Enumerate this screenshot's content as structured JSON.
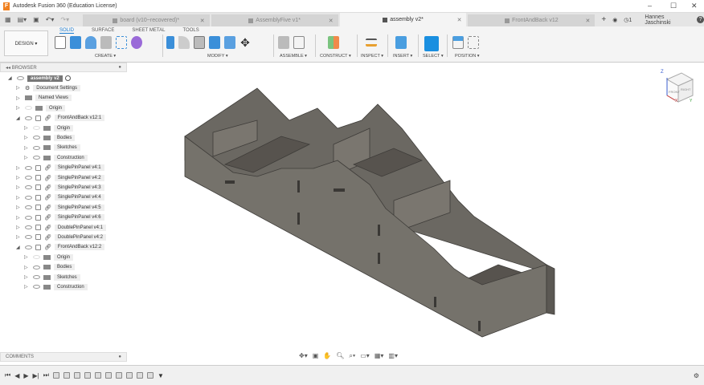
{
  "window": {
    "title": "Autodesk Fusion 360 (Education License)",
    "min": "–",
    "max": "☐",
    "close": "✕"
  },
  "tabs": [
    {
      "label": "board (v10~recovered)*"
    },
    {
      "label": "AssemblyFive v1*"
    },
    {
      "label": "assembly v2*",
      "active": true
    },
    {
      "label": "FrontAndBack v12"
    }
  ],
  "user": {
    "name": "Hannes Jaschinski",
    "jobs": "1",
    "help": "?"
  },
  "toolbar": {
    "workspace": "DESIGN ▾",
    "tabs": [
      "SOLID",
      "SURFACE",
      "SHEET METAL",
      "TOOLS"
    ],
    "groups": [
      "CREATE ▾",
      "MODIFY ▾",
      "ASSEMBLE ▾",
      "CONSTRUCT ▾",
      "INSPECT ▾",
      "INSERT ▾",
      "SELECT ▾",
      "POSITION ▾"
    ]
  },
  "browser": {
    "title": "BROWSER",
    "root": "assembly v2",
    "items": [
      {
        "label": "Document Settings",
        "level": 1,
        "kind": "gear"
      },
      {
        "label": "Named Views",
        "level": 1,
        "kind": "folder"
      },
      {
        "label": "Origin",
        "level": 1,
        "kind": "folder"
      },
      {
        "label": "FrontAndBack v12:1",
        "level": 1,
        "kind": "comp",
        "open": true
      },
      {
        "label": "Origin",
        "level": 2,
        "kind": "folder"
      },
      {
        "label": "Bodies",
        "level": 2,
        "kind": "folder"
      },
      {
        "label": "Sketches",
        "level": 2,
        "kind": "folder"
      },
      {
        "label": "Construction",
        "level": 2,
        "kind": "folder"
      },
      {
        "label": "SinglePinPanel v4:1",
        "level": 1,
        "kind": "comp"
      },
      {
        "label": "SinglePinPanel v4:2",
        "level": 1,
        "kind": "comp"
      },
      {
        "label": "SinglePinPanel v4:3",
        "level": 1,
        "kind": "comp"
      },
      {
        "label": "SinglePinPanel v4:4",
        "level": 1,
        "kind": "comp"
      },
      {
        "label": "SinglePinPanel v4:5",
        "level": 1,
        "kind": "comp"
      },
      {
        "label": "SinglePinPanel v4:6",
        "level": 1,
        "kind": "comp"
      },
      {
        "label": "DoublePinPanel v4:1",
        "level": 1,
        "kind": "comp"
      },
      {
        "label": "DoublePinPanel v4:2",
        "level": 1,
        "kind": "comp"
      },
      {
        "label": "FrontAndBack v12:2",
        "level": 1,
        "kind": "comp",
        "open": true
      },
      {
        "label": "Origin",
        "level": 2,
        "kind": "folder"
      },
      {
        "label": "Bodies",
        "level": 2,
        "kind": "folder"
      },
      {
        "label": "Sketches",
        "level": 2,
        "kind": "folder"
      },
      {
        "label": "Construction",
        "level": 2,
        "kind": "folder"
      }
    ]
  },
  "comments": {
    "title": "COMMENTS"
  },
  "viewcube": {
    "front": "FRONT",
    "right": "RIGHT",
    "axis_z": "Z",
    "axis_x": "X",
    "axis_y": "Y"
  }
}
